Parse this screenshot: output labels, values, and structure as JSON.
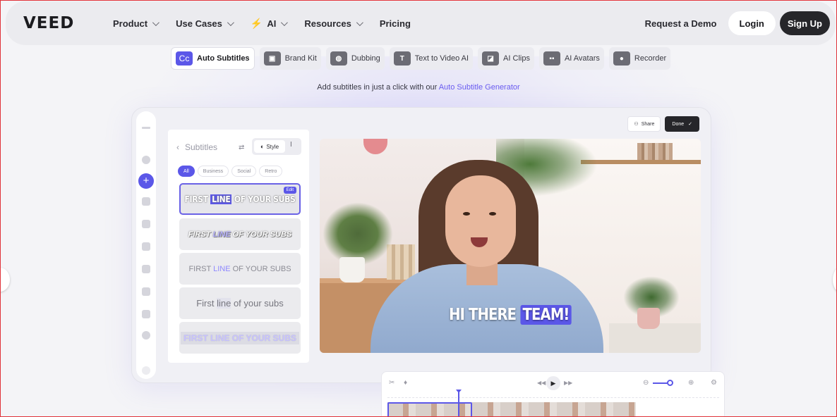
{
  "nav": {
    "logo": "VEED",
    "items": [
      {
        "label": "Product",
        "dropdown": true
      },
      {
        "label": "Use Cases",
        "dropdown": true
      },
      {
        "label": "AI",
        "dropdown": true,
        "icon": "bolt-icon"
      },
      {
        "label": "Resources",
        "dropdown": true
      },
      {
        "label": "Pricing",
        "dropdown": false
      }
    ],
    "request_demo": "Request a Demo",
    "login": "Login",
    "signup": "Sign Up"
  },
  "tabs": [
    {
      "label": "Auto Subtitles",
      "icon": "Cc",
      "active": true
    },
    {
      "label": "Brand Kit",
      "icon": ""
    },
    {
      "label": "Dubbing",
      "icon": ""
    },
    {
      "label": "Text to Video AI",
      "icon": "T"
    },
    {
      "label": "AI Clips",
      "icon": ""
    },
    {
      "label": "AI Avatars",
      "icon": ""
    },
    {
      "label": "Recorder",
      "icon": ""
    }
  ],
  "tagline": {
    "text": "Add subtitles in just a click with our ",
    "link": "Auto Subtitle Generator"
  },
  "editor": {
    "panel_title": "Subtitles",
    "style_button": "Style",
    "filters": [
      "All",
      "Business",
      "Social",
      "Retro"
    ],
    "active_filter": "All",
    "edit_badge": "Edit",
    "presets": [
      {
        "pre": "FIRST ",
        "hl": "LINE",
        "post": " OF YOUR SUBS"
      },
      {
        "pre": "FIRST ",
        "hl": "LINE",
        "post": " OF YOUR SUBS"
      },
      {
        "pre": "FIRST ",
        "hl": "LINE",
        "post": " OF YOUR SUBS"
      },
      {
        "pre": "First ",
        "hl": "line",
        "post": " of your subs"
      },
      {
        "pre": "FIRST ",
        "hl": "LINE",
        "post": " OF YOUR SUBS"
      }
    ],
    "share": "Share",
    "done": "Done",
    "caption": {
      "pre": "HI THERE ",
      "hl": "TEAM!"
    }
  },
  "colors": {
    "accent": "#5b57e8",
    "dark": "#26262a"
  }
}
